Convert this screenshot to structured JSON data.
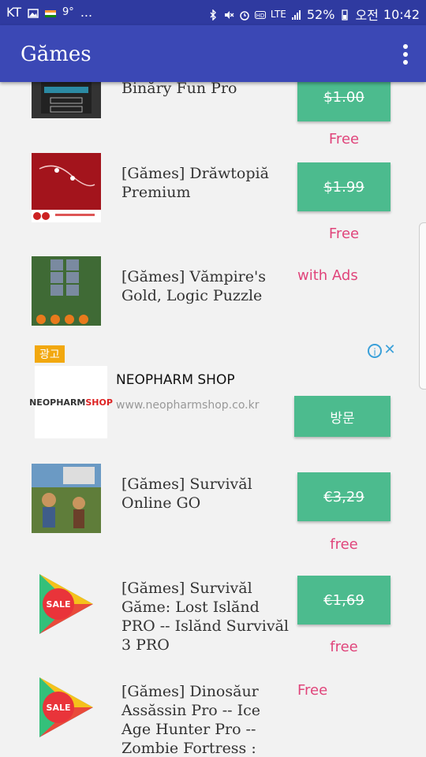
{
  "status_bar": {
    "carrier": "KT",
    "temp": "9°",
    "more": "...",
    "network": "LTE",
    "battery": "52%",
    "ampm": "오전",
    "time": "10:42"
  },
  "app_bar": {
    "title": "Gămes"
  },
  "items": [
    {
      "name": "Binăry Fun Pro",
      "price": "$1.00",
      "offer": "Free"
    },
    {
      "name": "[Gămes] Drăwtopiă Premium",
      "price": "$1.99",
      "offer": "Free"
    },
    {
      "name": "[Gămes] Vămpire's Gold, Logic Puzzle",
      "offer": "with Ads"
    },
    {
      "name": "[Gămes] Survivăl Online GO",
      "price": "€3,29",
      "offer": "free"
    },
    {
      "name": "[Gămes] Survivăl Găme: Lost Islănd PRO -- Islănd Survivăl 3 PRO",
      "price": "€1,69",
      "offer": "free"
    },
    {
      "name": "[Gămes] Dinosăur Assăssin Pro -- Ice Age Hunter Pro -- Zombie Fortress :",
      "offer": "Free"
    }
  ],
  "ad": {
    "badge": "광고",
    "info": "i",
    "close": "✕",
    "logo_a": "NEOPHARM",
    "logo_b": "SHOP",
    "title": "NEOPHARM SHOP",
    "url": "www.neopharmshop.co.kr",
    "button": "방문"
  },
  "sale_label": "SALE",
  "colors": {
    "primary": "#3b48b5",
    "status": "#2f3aa0",
    "accent": "#4cbb8e",
    "pink": "#e0457b"
  }
}
